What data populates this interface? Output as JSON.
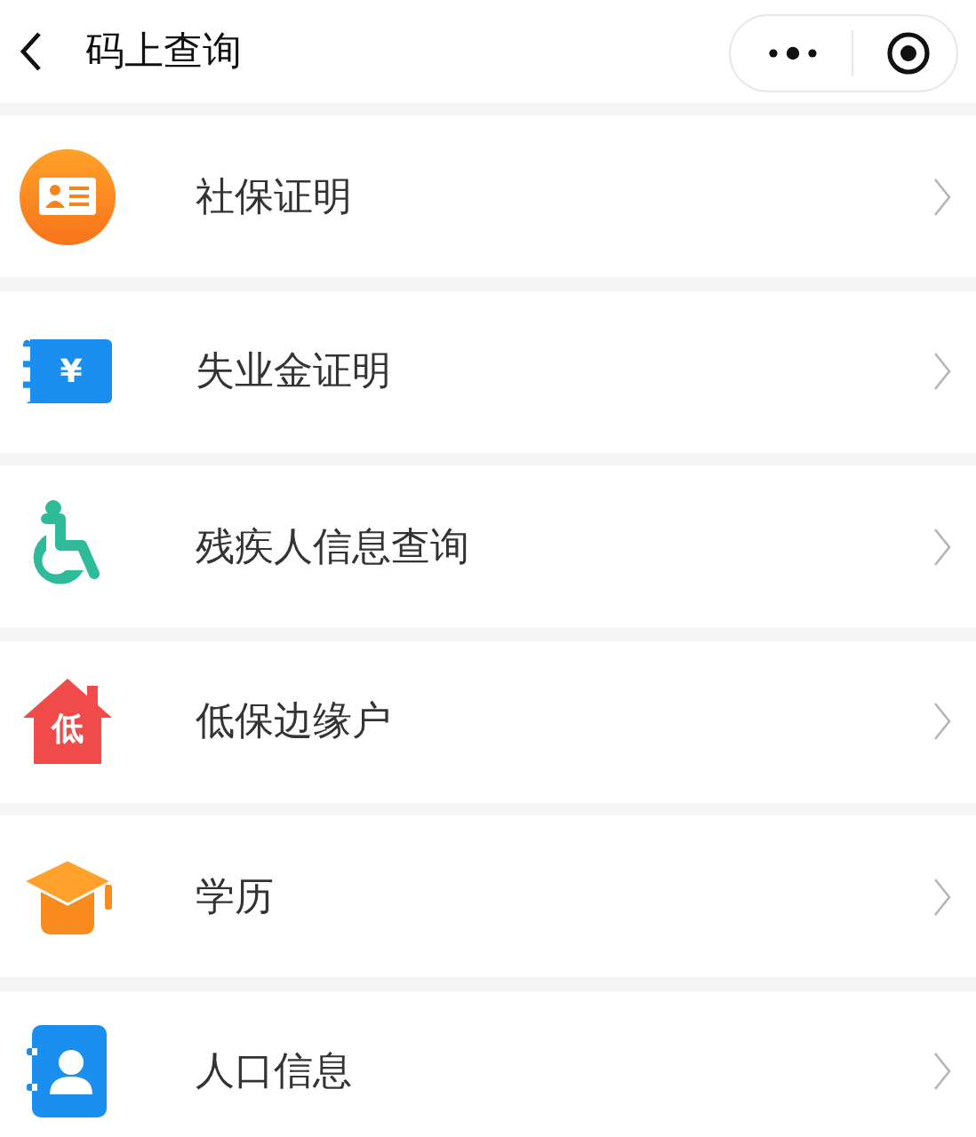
{
  "header": {
    "title": "码上查询"
  },
  "items": [
    {
      "kind": "id-card",
      "label": "社保证明"
    },
    {
      "kind": "ticket",
      "label": "失业金证明",
      "icon_text": "¥"
    },
    {
      "kind": "wheelchair",
      "label": "残疾人信息查询"
    },
    {
      "kind": "house",
      "label": "低保边缘户",
      "icon_text": "低"
    },
    {
      "kind": "cap",
      "label": "学历"
    },
    {
      "kind": "contact",
      "label": "人口信息"
    }
  ]
}
